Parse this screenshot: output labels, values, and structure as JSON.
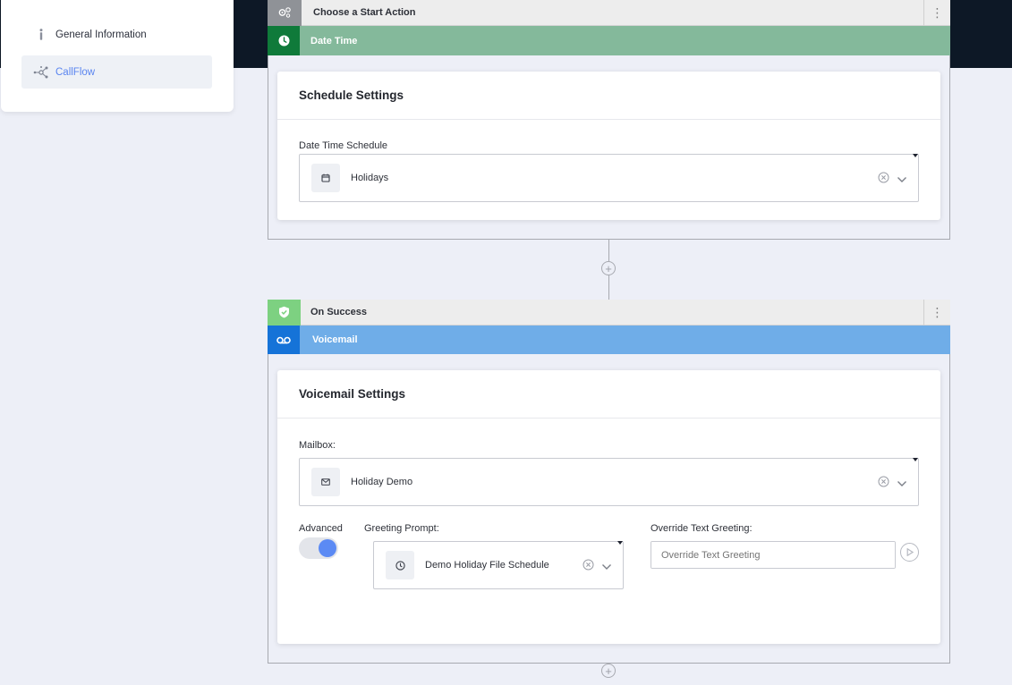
{
  "sidebar": {
    "items": [
      {
        "label": "General Information",
        "icon": "info-icon",
        "active": false
      },
      {
        "label": "CallFlow",
        "icon": "callflow-icon",
        "active": true
      }
    ]
  },
  "start_node": {
    "title": "Choose a Start Action",
    "icon": "gears-icon",
    "action": {
      "label": "Date Time",
      "icon": "clock-icon",
      "color": "#84b99b",
      "icon_bg": "#0f7a3a"
    },
    "card": {
      "title": "Schedule Settings",
      "field_label": "Date Time Schedule",
      "selected": "Holidays",
      "chip_icon": "calendar-icon"
    }
  },
  "success_node": {
    "title": "On Success",
    "icon": "shield-check-icon",
    "icon_bg": "#7dd181",
    "action": {
      "label": "Voicemail",
      "icon": "voicemail-icon",
      "color": "#6fade8",
      "icon_bg": "#1573d8"
    },
    "card": {
      "title": "Voicemail Settings",
      "mailbox_label": "Mailbox:",
      "mailbox_value": "Holiday Demo",
      "mailbox_icon": "envelope-icon",
      "advanced_label": "Advanced",
      "advanced_on": true,
      "greeting_label": "Greeting Prompt:",
      "greeting_value": "Demo Holiday File Schedule",
      "greeting_icon": "clock-icon",
      "override_label": "Override Text Greeting:",
      "override_placeholder": "Override Text Greeting"
    }
  },
  "colors": {
    "accent": "#5b8af4",
    "topbar": "#0d1826"
  }
}
